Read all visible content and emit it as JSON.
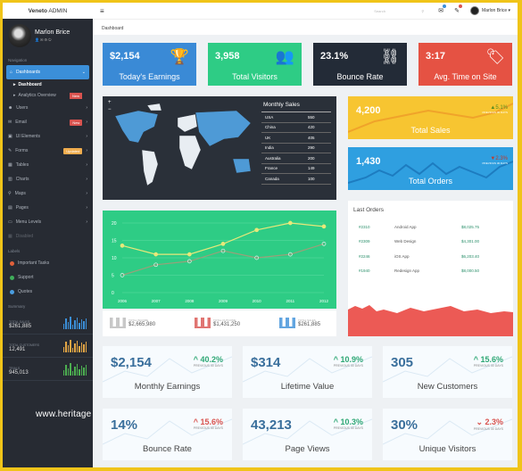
{
  "topbar": {
    "brand_bold": "Veneto",
    "brand_rest": " ADMIN",
    "search_placeholder": "Search",
    "user": "Marlon Brice ▾"
  },
  "sidebar": {
    "user": "Marlon Brice",
    "section_nav": "Navigation",
    "items": [
      {
        "label": "Dashboards",
        "icon": "home-icon",
        "active": true
      },
      {
        "label": "Users",
        "icon": "user-icon"
      },
      {
        "label": "Email",
        "icon": "mail-icon",
        "badge": "New",
        "badge_color": "#d9534f"
      },
      {
        "label": "UI Elements",
        "icon": "briefcase-icon"
      },
      {
        "label": "Forms",
        "icon": "edit-icon",
        "badge": "Updated",
        "badge_color": "#f0ad4e"
      },
      {
        "label": "Tables",
        "icon": "table-icon"
      },
      {
        "label": "Charts",
        "icon": "chart-icon"
      },
      {
        "label": "Maps",
        "icon": "map-marker-icon"
      },
      {
        "label": "Pages",
        "icon": "file-icon"
      },
      {
        "label": "Menu Levels",
        "icon": "folder-icon"
      },
      {
        "label": "Disabled",
        "icon": "grid-icon",
        "disabled": true
      }
    ],
    "subitems": [
      {
        "label": "Dashboard"
      },
      {
        "label": "Analytics Overview",
        "badge": "New"
      }
    ],
    "section_labels": "Labels",
    "labels": [
      {
        "label": "Important Tasks",
        "color": "#e0603a"
      },
      {
        "label": "Support",
        "color": "#3fae5a"
      },
      {
        "label": "Quotes",
        "color": "#4a9de0"
      }
    ],
    "section_summary": "Summary",
    "summary": [
      {
        "label": "TOTAL SALES",
        "value": "$261,885",
        "color": "#3b8fd9"
      },
      {
        "label": "TOTAL CUSTOMERS",
        "value": "12,491",
        "color": "#e3a544"
      },
      {
        "label": "TRIALS",
        "value": "945,013",
        "color": "#4caf50"
      }
    ]
  },
  "watermark": "www.heritage",
  "breadcrumb": "Dashboard",
  "tiles": [
    {
      "value": "$2,154",
      "label": "Today's Earnings",
      "icon": "trophy-icon",
      "color": "#3a8ad6"
    },
    {
      "value": "3,958",
      "label": "Total Visitors",
      "icon": "users-icon",
      "color": "#2ecc85"
    },
    {
      "value": "23.1%",
      "label": "Bounce Rate",
      "icon": "unlink-icon",
      "color": "#232b37"
    },
    {
      "value": "3:17",
      "label": "Avg. Time on Site",
      "icon": "tag-icon",
      "color": "#e55243"
    }
  ],
  "monthly_sales": {
    "title": "Monthly Sales",
    "rows": [
      [
        "USA",
        "550"
      ],
      [
        "China",
        "420"
      ],
      [
        "UK",
        "405"
      ],
      [
        "India",
        "290"
      ],
      [
        "Australia",
        "200"
      ],
      [
        "France",
        "149"
      ],
      [
        "Canada",
        "100"
      ]
    ]
  },
  "total_sales": {
    "value": "4,200",
    "label": "Total Sales",
    "change": "▲5.1%",
    "sub": "PREVIOUS 30 DAYS",
    "color": "#f7c531"
  },
  "total_orders": {
    "value": "1,430",
    "label": "Total Orders",
    "change": "▼2.3%",
    "sub": "PREVIOUS 30 DAYS",
    "color": "#2f9fe0"
  },
  "chart_data": {
    "type": "line",
    "categories": [
      "2006",
      "2007",
      "2008",
      "2009",
      "2010",
      "2011",
      "2012"
    ],
    "series": [
      {
        "values": [
          13.5,
          11,
          11,
          14,
          18,
          20,
          19
        ],
        "color": "#e8e87a"
      },
      {
        "values": [
          5,
          8,
          9,
          12,
          10,
          11,
          14
        ],
        "color": "#9aa07a"
      }
    ],
    "yticks": [
      "0",
      "5",
      "10",
      "15",
      "20"
    ],
    "ylim": [
      0,
      20
    ],
    "grid": true,
    "background": "#2ecc85"
  },
  "mini_stats": [
    {
      "label": "TOTAL INCOME",
      "value": "$2,665,980"
    },
    {
      "label": "TOTAL OUTCOME",
      "value": "$1,431,250"
    },
    {
      "label": "TOTAL SALES",
      "value": "$261,885"
    }
  ],
  "last_orders": {
    "title": "Last Orders",
    "rows": [
      [
        "#2310",
        "Android App",
        "$8,025.75"
      ],
      [
        "#2309",
        "Web Design",
        "$4,301.00"
      ],
      [
        "#2246",
        "iOS App",
        "$6,203.40"
      ],
      [
        "#1940",
        "Redesign App",
        "$8,000.50"
      ]
    ]
  },
  "stat_cards": [
    {
      "value": "$2,154",
      "change": "40.2%",
      "dir": "up",
      "sub": "PREVIOUS 30 DAYS",
      "label": "Monthly Earnings"
    },
    {
      "value": "$314",
      "change": "10.9%",
      "dir": "up",
      "sub": "PREVIOUS 30 DAYS",
      "label": "Lifetime Value"
    },
    {
      "value": "305",
      "change": "15.6%",
      "dir": "up",
      "sub": "PREVIOUS 30 DAYS",
      "label": "New Customers"
    },
    {
      "value": "14%",
      "change": "15.6%",
      "dir": "up-red",
      "sub": "PREVIOUS 30 DAYS",
      "label": "Bounce Rate"
    },
    {
      "value": "43,213",
      "change": "10.3%",
      "dir": "up",
      "sub": "PREVIOUS 30 DAYS",
      "label": "Page Views"
    },
    {
      "value": "30%",
      "change": "2.3%",
      "dir": "down",
      "sub": "PREVIOUS 30 DAYS",
      "label": "Unique Visitors"
    }
  ]
}
